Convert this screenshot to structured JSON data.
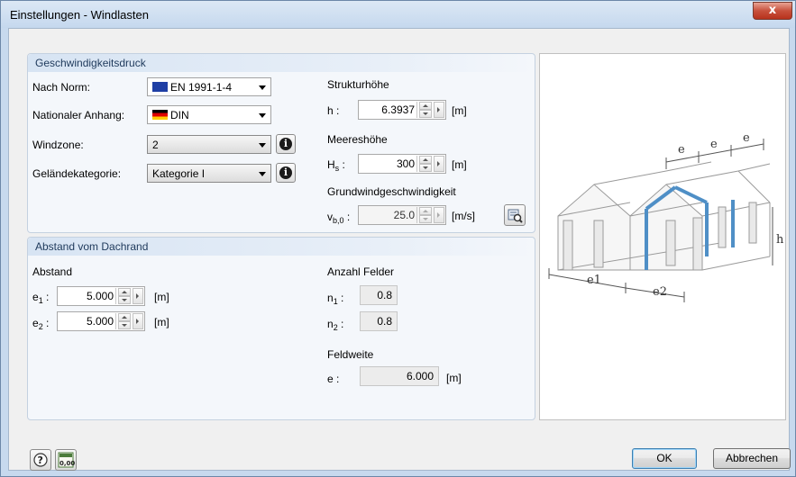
{
  "window": {
    "title": "Einstellungen - Windlasten",
    "close_label": "x"
  },
  "velocity_pressure": {
    "header": "Geschwindigkeitsdruck",
    "norm_label": "Nach Norm:",
    "norm_value": "EN 1991-1-4",
    "annex_label": "Nationaler Anhang:",
    "annex_value": "DIN",
    "windzone_label": "Windzone:",
    "windzone_value": "2",
    "terrain_label": "Geländekategorie:",
    "terrain_value": "Kategorie I",
    "structure_height_label": "Strukturhöhe",
    "h_label": "h :",
    "h_value": "6.3937",
    "h_unit": "[m]",
    "altitude_label": "Meereshöhe",
    "hs_label": "H",
    "hs_sub": "s",
    "hs_colon": " :",
    "hs_value": "300",
    "hs_unit": "[m]",
    "basic_wind_label": "Grundwindgeschwindigkeit",
    "vb_label": "v",
    "vb_sub": "b,0",
    "vb_colon": " :",
    "vb_value": "25.0",
    "vb_unit": "[m/s]"
  },
  "roof_edge": {
    "header": "Abstand vom Dachrand",
    "distance_label": "Abstand",
    "e1_label": "e",
    "e1_sub": "1",
    "e1_colon": " :",
    "e1_value": "5.000",
    "e1_unit": "[m]",
    "e2_label": "e",
    "e2_sub": "2",
    "e2_colon": " :",
    "e2_value": "5.000",
    "e2_unit": "[m]",
    "fields_label": "Anzahl Felder",
    "n1_label": "n",
    "n1_sub": "1",
    "n1_colon": " :",
    "n1_value": "0.8",
    "n2_label": "n",
    "n2_sub": "2",
    "n2_colon": " :",
    "n2_value": "0.8",
    "field_width_label": "Feldweite",
    "e_label": "e :",
    "e_value": "6.000",
    "e_unit": "[m]"
  },
  "diagram": {
    "label_e_a": "e",
    "label_e_b": "e",
    "label_e_c": "e",
    "label_h": "h",
    "label_e1": "e1",
    "label_e2": "e2"
  },
  "footer": {
    "ok_label": "OK",
    "cancel_label": "Abbrechen",
    "calc_label": "0,00"
  },
  "colors": {
    "accent": "#1e395b",
    "group_bg": "#f4f7fb",
    "highlight_frame": "#4f8fc6"
  }
}
